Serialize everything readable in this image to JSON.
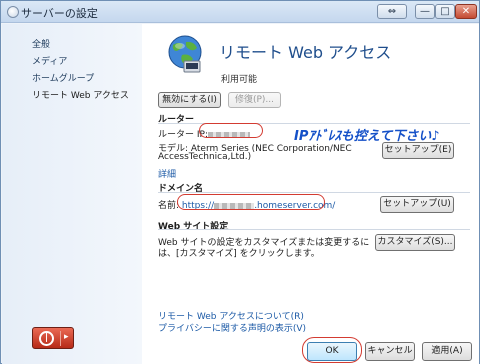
{
  "window": {
    "title": "サーバーの設定",
    "help_label": "",
    "min_label": "—",
    "max_label": "□",
    "close_label": "✕"
  },
  "sidebar": {
    "items": [
      {
        "label": "全般"
      },
      {
        "label": "メディア"
      },
      {
        "label": "ホームグループ"
      },
      {
        "label": "リモート Web アクセス"
      }
    ]
  },
  "header": {
    "title": "リモート Web アクセス",
    "status": "利用可能",
    "disable_button": "無効にする(I)",
    "repair_button": "修復(P)..."
  },
  "router": {
    "section_title": "ルーター",
    "ip_label": "ルーター IP:",
    "model_label": "モデル: Aterm Series (NEC Corporation/NEC",
    "model_label_2": "AccessTechnica,Ltd.)",
    "details_link": "詳細",
    "setup_button": "セットアップ(E)"
  },
  "annotation": {
    "text": "IPｱﾄﾞﾚｽも控えて下さい♪"
  },
  "domain": {
    "section_title": "ドメイン名",
    "name_label": "名前:",
    "url_prefix": "https://",
    "url_suffix": ".homeserver.com/",
    "setup_button": "セットアップ(U)"
  },
  "website": {
    "section_title": "Web サイト設定",
    "description_1": "Web サイトの設定をカスタマイズまたは変更するに",
    "description_2": "は、[カスタマイズ] をクリックします。",
    "customize_button": "カスタマイズ(S)..."
  },
  "links": {
    "about": "リモート Web アクセスについて(R)",
    "privacy": "プライバシーに関する声明の表示(V)"
  },
  "footer": {
    "ok": "OK",
    "cancel": "キャンセル",
    "apply": "適用(A)"
  },
  "colors": {
    "accent": "#1f4e8c",
    "highlight": "#d33b31",
    "annotation": "#1450c8"
  }
}
